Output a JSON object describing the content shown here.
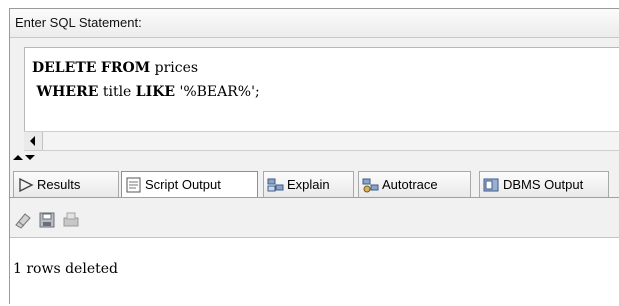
{
  "sql_panel": {
    "header_label": "Enter SQL Statement:",
    "code_line1": {
      "keyword1": "DELETE",
      "keyword2": "FROM",
      "rest": " prices"
    },
    "code_line2": {
      "indent": " ",
      "keyword1": "WHERE",
      "middle": " title ",
      "keyword2": "LIKE",
      "rest": " '%BEAR%';"
    }
  },
  "tabs": [
    {
      "label": "Results",
      "icon": "play-icon",
      "active": false
    },
    {
      "label": "Script Output",
      "icon": "script-icon",
      "active": true
    },
    {
      "label": "Explain",
      "icon": "explain-icon",
      "active": false
    },
    {
      "label": "Autotrace",
      "icon": "autotrace-icon",
      "active": false
    },
    {
      "label": "DBMS Output",
      "icon": "dbms-output-icon",
      "active": false
    }
  ],
  "toolbar": {
    "icons": [
      "eraser-icon",
      "save-icon",
      "print-icon"
    ]
  },
  "output": {
    "text": "1 rows deleted"
  }
}
